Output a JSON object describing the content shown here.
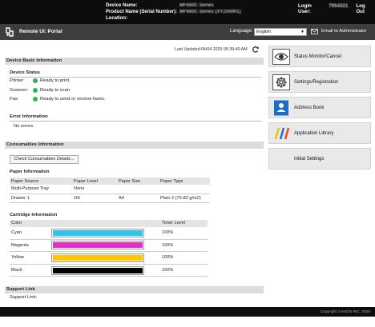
{
  "header": {
    "device_name_label": "Device Name:",
    "device_name_value": "MF660C Series",
    "product_name_label": "Product Name (Serial Number):",
    "product_name_value": "MF660C Series (XYZ00001)",
    "location_label": "Location:",
    "login_user_label": "Login User:",
    "login_user_value": "7654321",
    "logout_label": "Log Out"
  },
  "titlebar": {
    "title": "Remote UI: Portal",
    "language_label": "Language:",
    "language_value": "English",
    "email_admin": "Email to Administrator"
  },
  "last_updated": "Last Updated:04/04 2025 05:39:40 AM",
  "device_basic": {
    "heading": "Device Basic Information",
    "status_heading": "Device Status",
    "rows": [
      {
        "key": "Printer:",
        "value": "Ready to print."
      },
      {
        "key": "Scanner:",
        "value": "Ready to scan."
      },
      {
        "key": "Fax:",
        "value": "Ready to send or receive faxes."
      }
    ],
    "error_heading": "Error Information",
    "error_value": "No errors."
  },
  "consumables": {
    "heading": "Consumables Information",
    "check_button": "Check Consumables Details...",
    "paper_heading": "Paper Information",
    "paper_columns": [
      "Paper Source",
      "Paper Level",
      "Paper Size",
      "Paper Type"
    ],
    "paper_rows": [
      [
        "Multi-Purpose Tray",
        "None",
        "",
        ""
      ],
      [
        "Drawer 1",
        "OK",
        "A4",
        "Plain 2 (75-82 g/m2)"
      ]
    ],
    "cartridge_heading": "Cartridge Information",
    "cartridge_columns": [
      "Color",
      "Toner Level"
    ],
    "cartridges": [
      {
        "name": "Cyan",
        "level": "100%",
        "color": "#2ec5ec",
        "fraction": 1.0
      },
      {
        "name": "Magenta",
        "level": "100%",
        "color": "#e62ec9",
        "fraction": 1.0
      },
      {
        "name": "Yellow",
        "level": "100%",
        "color": "#ffc600",
        "fraction": 1.0
      },
      {
        "name": "Black",
        "level": "100%",
        "color": "#000000",
        "fraction": 1.0
      }
    ]
  },
  "support": {
    "heading": "Support Link",
    "label": "Support Link:"
  },
  "nav": [
    {
      "label": "Status Monitor/Cancel",
      "icon": "status-monitor-icon"
    },
    {
      "label": "Settings/Registration",
      "icon": "settings-icon"
    },
    {
      "label": "Address Book",
      "icon": "address-book-icon"
    },
    {
      "label": "Application Library",
      "icon": "application-library-icon"
    },
    {
      "label": "Initial Settings",
      "icon": ""
    }
  ],
  "footer": {
    "copyright": "Copyright CANON INC. 2025"
  },
  "colors": {
    "accent": "#2fb355",
    "header": "#0d0d0d",
    "titlebar": "#3d3d3d"
  }
}
